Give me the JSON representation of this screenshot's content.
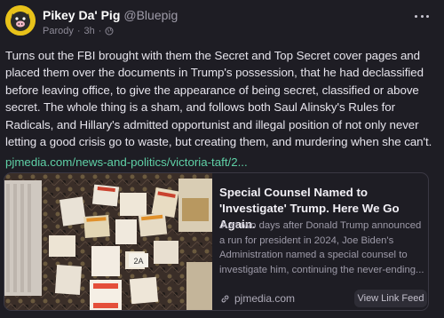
{
  "post": {
    "display_name": "Pikey Da' Pig",
    "handle": "@Bluepig",
    "label": "Parody",
    "time": "3h",
    "body": "Turns out the FBI brought with them the Secret and Top Secret cover pages and placed them over the documents in Trump's possession, that he had declassified before leaving office, to give the appearance of being secret, classified or above secret. The whole thing is a sham, and follows both Saul Alinsky's Rules for Radicals, and Hillary's admitted opportunist and illegal position of not only never letting a good crisis go to waste, but creating them, and murdering when she can't.",
    "link_text": "pjmedia.com/news-and-politics/victoria-taft/2..."
  },
  "card": {
    "title": "Special Counsel Named to 'Investigate' Trump. Here We Go Again.",
    "description": "Just two days after Donald Trump announced a run for president in 2024, Joe Biden's Administration named a special counsel to investigate him, continuing the never-ending...",
    "domain": "pjmedia.com",
    "view_feed_label": "View Link Feed",
    "image_label": "2A"
  },
  "colors": {
    "background": "#1e1d24",
    "link": "#5fd0a6",
    "avatar": "#e8c21a"
  },
  "icons": [
    "avatar-pig",
    "globe-icon",
    "more-icon",
    "link-icon"
  ]
}
